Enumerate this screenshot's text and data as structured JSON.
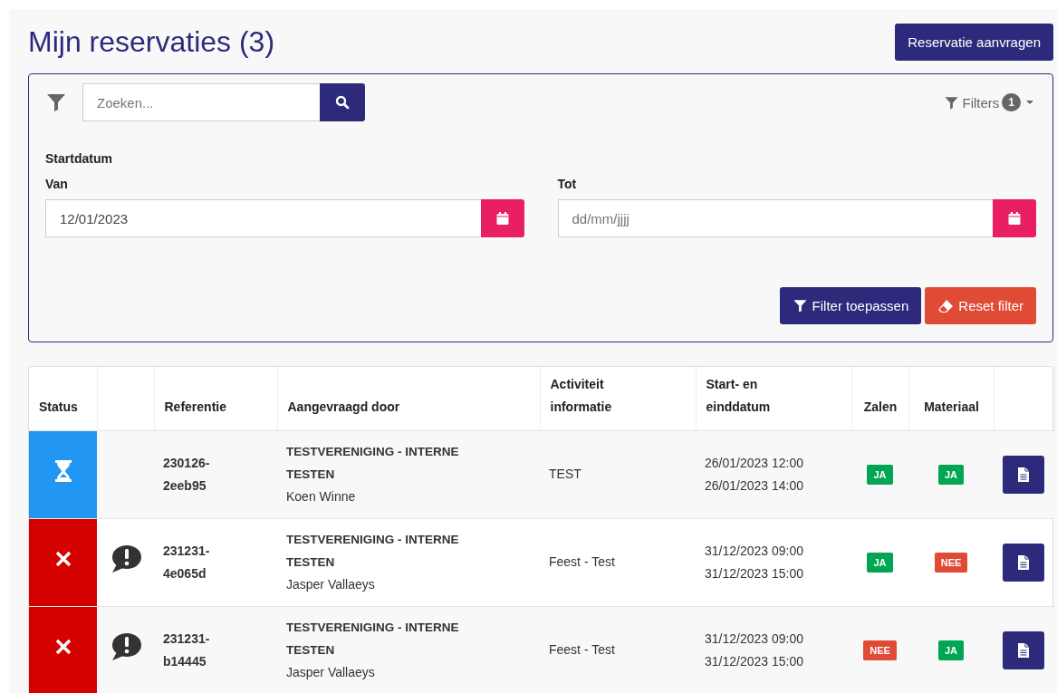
{
  "page": {
    "title": "Mijn reservaties (3)",
    "action_button": "Reservatie aanvragen"
  },
  "filter_panel": {
    "search": {
      "placeholder": "Zoeken..."
    },
    "filters_toggle": {
      "label": "Filters",
      "count": "1"
    },
    "section_label": "Startdatum",
    "date_fields": [
      {
        "label": "Van",
        "value": "12/01/2023"
      },
      {
        "label": "Tot",
        "placeholder": "dd/mm/jjjj"
      }
    ],
    "buttons": [
      {
        "kind": "apply",
        "label": "Filter toepassen"
      },
      {
        "kind": "reset",
        "label": "Reset filter"
      }
    ]
  },
  "table": {
    "columns": [
      [
        "Status"
      ],
      [],
      [
        "Referentie"
      ],
      [
        "Aangevraagd door"
      ],
      [
        "Activiteit",
        "informatie"
      ],
      [
        "Start- en",
        "einddatum"
      ],
      [
        "Zalen"
      ],
      [
        "Materiaal"
      ],
      []
    ],
    "rows": [
      {
        "kind": "pending",
        "has_comment": false,
        "reference": [
          "230126-",
          "2eeb95"
        ],
        "organisation": "TESTVERENIGING - INTERNE TESTEN",
        "person": "Koen Winne",
        "activity": "TEST",
        "start": "26/01/2023 12:00",
        "end": "26/01/2023 14:00",
        "rooms": {
          "kind": "yes",
          "label": "JA"
        },
        "material": {
          "kind": "yes",
          "label": "JA"
        }
      },
      {
        "kind": "rejected",
        "has_comment": true,
        "reference": [
          "231231-",
          "4e065d"
        ],
        "organisation": "TESTVERENIGING - INTERNE TESTEN",
        "person": "Jasper Vallaeys",
        "activity": "Feest - Test",
        "start": "31/12/2023 09:00",
        "end": "31/12/2023 15:00",
        "rooms": {
          "kind": "yes",
          "label": "JA"
        },
        "material": {
          "kind": "no",
          "label": "NEE"
        }
      },
      {
        "kind": "rejected",
        "has_comment": true,
        "reference": [
          "231231-",
          "b14445"
        ],
        "organisation": "TESTVERENIGING - INTERNE TESTEN",
        "person": "Jasper Vallaeys",
        "activity": "Feest - Test",
        "start": "31/12/2023 09:00",
        "end": "31/12/2023 15:00",
        "rooms": {
          "kind": "no",
          "label": "NEE"
        },
        "material": {
          "kind": "yes",
          "label": "JA"
        }
      }
    ]
  }
}
